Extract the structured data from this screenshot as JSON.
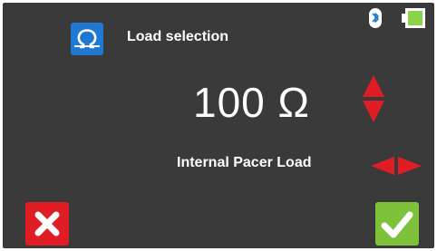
{
  "header": {
    "title": "Load selection",
    "icon": "omega-icon",
    "status": {
      "bluetooth_icon": "bluetooth-icon",
      "battery_icon": "battery-icon",
      "battery_color": "#8bd44a"
    }
  },
  "main": {
    "value": "100 Ω",
    "label": "Internal Pacer Load"
  },
  "controls": {
    "up_down_icon": "up-down-arrows-icon",
    "left_right_icon": "left-right-arrows-icon",
    "cancel_icon": "close-icon",
    "confirm_icon": "check-icon"
  },
  "colors": {
    "background": "#3a3a3a",
    "accent_blue": "#1f78d1",
    "arrow_red": "#e01d24",
    "confirm_green": "#7ec23c"
  }
}
